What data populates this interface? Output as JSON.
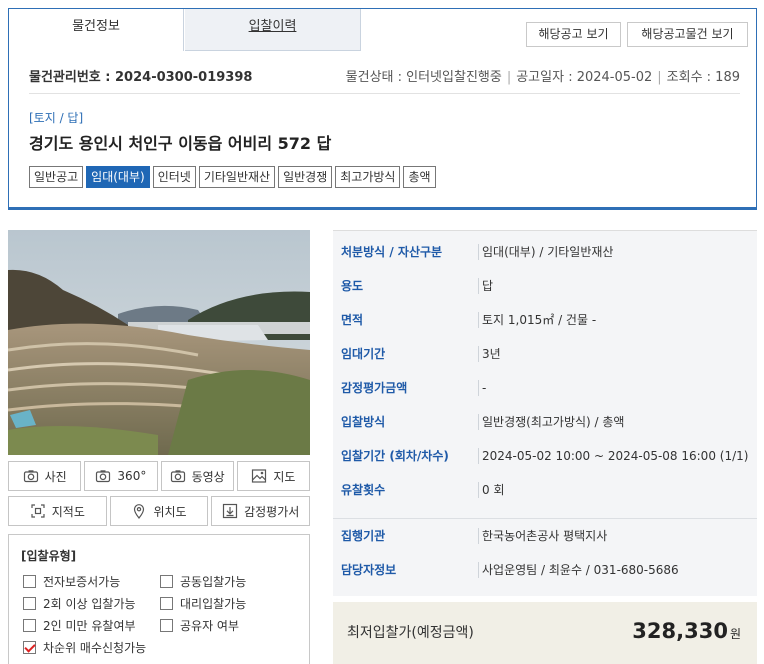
{
  "tabs": {
    "info": "물건정보",
    "history": "입찰이력"
  },
  "header_buttons": {
    "notice": "해당공고 보기",
    "notice_items": "해당공고물건 보기"
  },
  "item": {
    "mgmt_no": "물건관리번호 : 2024-0300-019398",
    "status": "물건상태 : 인터넷입찰진행중",
    "notice_date": "공고일자 : 2024-05-02",
    "views": "조회수 : 189",
    "category": "[토지 / 답]",
    "address": "경기도 용인시 처인구 이동읍 어비리 572 답"
  },
  "tags": [
    {
      "label": "일반공고",
      "active": false
    },
    {
      "label": "임대(대부)",
      "active": true
    },
    {
      "label": "인터넷",
      "active": false
    },
    {
      "label": "기타일반재산",
      "active": false
    },
    {
      "label": "일반경쟁",
      "active": false
    },
    {
      "label": "최고가방식",
      "active": false
    },
    {
      "label": "총액",
      "active": false
    }
  ],
  "media_buttons": [
    {
      "label": "사진",
      "icon": "camera-icon"
    },
    {
      "label": "360°",
      "icon": "camera-360-icon"
    },
    {
      "label": "동영상",
      "icon": "video-camera-icon"
    },
    {
      "label": "지도",
      "icon": "map-icon"
    },
    {
      "label": "지적도",
      "icon": "cadastral-map-icon"
    },
    {
      "label": "위치도",
      "icon": "location-pin-icon"
    },
    {
      "label": "감정평가서",
      "icon": "download-icon"
    }
  ],
  "bid_types": {
    "title": "[입찰유형]",
    "options": [
      {
        "label": "전자보증서가능",
        "checked": false
      },
      {
        "label": "공동입찰가능",
        "checked": false
      },
      {
        "label": "2회 이상 입찰가능",
        "checked": false
      },
      {
        "label": "대리입찰가능",
        "checked": false
      },
      {
        "label": "2인 미만 유찰여부",
        "checked": false
      },
      {
        "label": "공유자 여부",
        "checked": false
      },
      {
        "label": "차순위 매수신청가능",
        "checked": true
      }
    ]
  },
  "details": [
    {
      "label": "처분방식 / 자산구분",
      "value": "임대(대부) / 기타일반재산"
    },
    {
      "label": "용도",
      "value": "답"
    },
    {
      "label": "면적",
      "value": "토지 1,015㎡ / 건물 -"
    },
    {
      "label": "임대기간",
      "value": "3년"
    },
    {
      "label": "감정평가금액",
      "value": "-"
    },
    {
      "label": "입찰방식",
      "value": "일반경쟁(최고가방식) / 총액"
    },
    {
      "label": "입찰기간 (회차/차수)",
      "value": "2024-05-02 10:00 ~ 2024-05-08 16:00 (1/1)"
    },
    {
      "label": "유찰횟수",
      "value": "0 회"
    },
    {
      "label": "집행기관",
      "value": "한국농어촌공사 평택지사"
    },
    {
      "label": "담당자정보",
      "value": "사업운영팀 / 최윤수 / 031-680-5686"
    }
  ],
  "min_price": {
    "label": "최저입찰가(예정금액)",
    "value": "328,330",
    "unit": "원"
  },
  "colors": {
    "accent": "#2e6fb6",
    "active_tag": "#1f67b5",
    "label_blue": "#1f5aa8",
    "check_red": "#dd2222"
  }
}
